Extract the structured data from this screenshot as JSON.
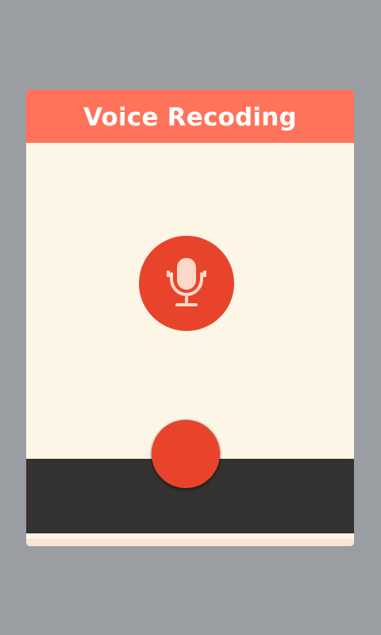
{
  "dialog": {
    "title": "Voice Recoding"
  },
  "icons": {
    "mic": "microphone-icon"
  },
  "colors": {
    "background": "#9a9ea2",
    "header": "#ff735b",
    "panel": "#fdf6e6",
    "accent": "#e8442c",
    "bottom_bar": "#343332",
    "mic_glyph": "#fcd9c6"
  }
}
